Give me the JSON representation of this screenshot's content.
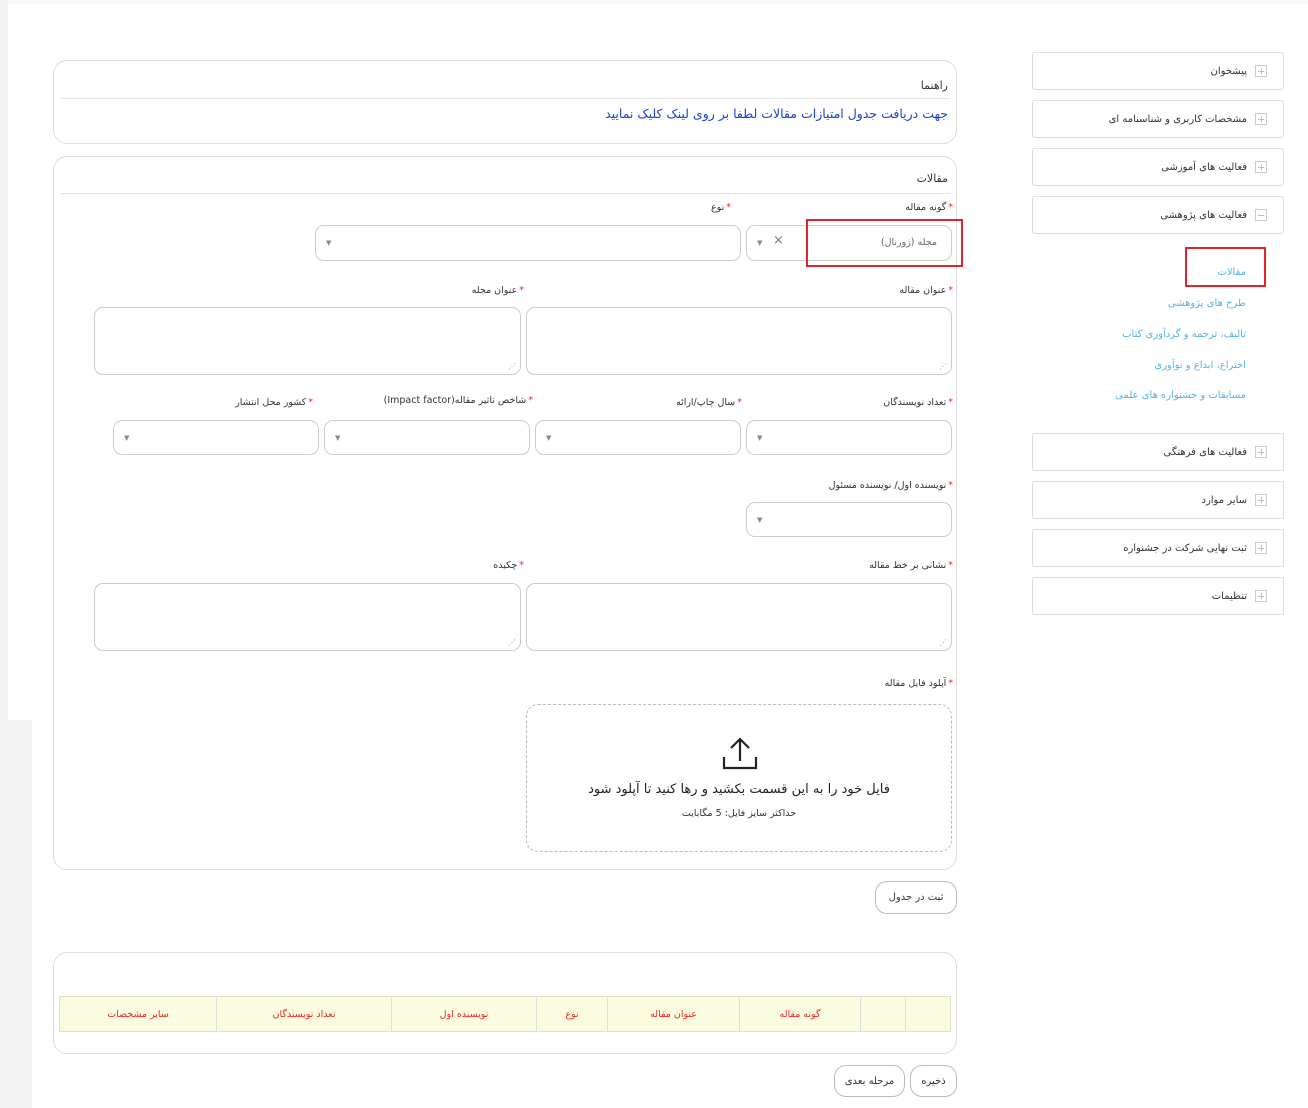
{
  "sidebar": {
    "items": [
      {
        "label": "پیشخوان",
        "icon": "plus-icon"
      },
      {
        "label": "مشخصات کاربری و شناسنامه ای",
        "icon": "plus-icon"
      },
      {
        "label": "فعالیت های آموزشی",
        "icon": "plus-icon"
      },
      {
        "label": "فعالیت های پژوهشی",
        "icon": "minus-icon"
      },
      {
        "label": "فعالیت های فرهنگی",
        "icon": "plus-icon"
      },
      {
        "label": "سایر موارد",
        "icon": "plus-icon"
      },
      {
        "label": "ثبت نهایی شرکت در جشنواره",
        "icon": "plus-icon"
      },
      {
        "label": "تنظیمات",
        "icon": "plus-icon"
      }
    ],
    "research_sub": [
      {
        "label": "مقالات",
        "active": true
      },
      {
        "label": "طرح های پژوهشی"
      },
      {
        "label": "تالیف، ترجمه و گردآوری کتاب"
      },
      {
        "label": "اختراع، ابداع و نوآوری"
      },
      {
        "label": "مسابقات و جشنواره های علمی"
      }
    ]
  },
  "guide": {
    "title": "راهنما",
    "link": "جهت دریافت جدول امتیازات مقالات لطفا بر روی لینک کلیک نمایید"
  },
  "form": {
    "title": "مقالات",
    "article_kind_label": "گونه مقاله",
    "article_kind_value": "مجله (ژورنال)",
    "type_label": "نوع",
    "article_title_label": "عنوان مقاله",
    "journal_title_label": "عنوان مجله",
    "authors_count_label": "تعداد نویسندگان",
    "pub_year_label": "سال چاپ/ارائه",
    "impact_factor_label": "شاخص تاثیر مقاله(Impact factor)",
    "country_label": "کشور محل انتشار",
    "first_author_label": "نویسنده اول/ نویسنده مسئول",
    "online_url_label": "نشانی بر خط مقاله",
    "abstract_label": "چکیده",
    "upload_label": "آپلود فایل مقاله",
    "upload_hint": "فایل خود را به این قسمت بکشید و رها کنید تا آپلود شود",
    "upload_max": "حداکثر سایز فایل: 5 مگابایت",
    "clear_symbol": "×",
    "dropdown_arrow": "▼"
  },
  "buttons": {
    "add_to_table": "ثبت در جدول",
    "save": "ذخیره",
    "next": "مرحله بعدی"
  },
  "table": {
    "headers": [
      "",
      "",
      "گونه مقاله",
      "عنوان مقاله",
      "نوع",
      "نویسنده اول",
      "تعداد نویسندگان",
      "سایر مشخصات"
    ]
  },
  "colors": {
    "accent_blue": "#1a3fd1",
    "link_light": "#5bb0e6",
    "required_red": "#e52a2a",
    "highlight_red": "#e3232c",
    "table_header_bg": "#fbfbdf"
  }
}
